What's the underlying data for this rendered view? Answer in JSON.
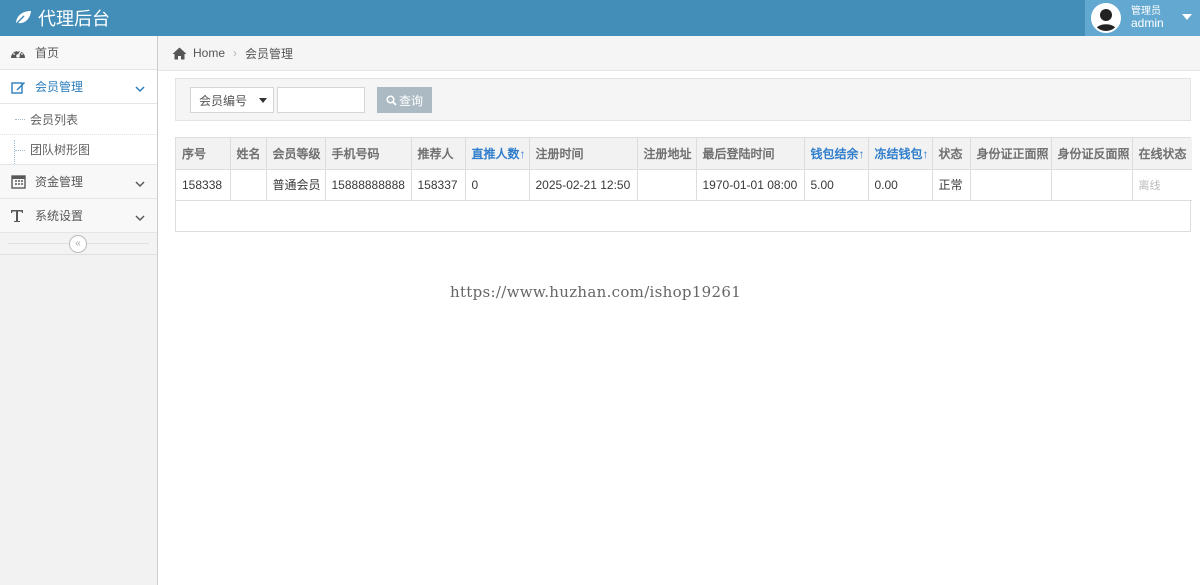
{
  "app": {
    "title": "代理后台"
  },
  "user": {
    "role": "管理员",
    "name": "admin"
  },
  "sidebar": {
    "items": [
      {
        "label": "首页",
        "icon": "dashboard-icon"
      },
      {
        "label": "会员管理",
        "icon": "edit-icon",
        "active": true,
        "children": [
          {
            "label": "会员列表"
          },
          {
            "label": "团队树形图"
          }
        ]
      },
      {
        "label": "资金管理",
        "icon": "calendar-icon"
      },
      {
        "label": "系统设置",
        "icon": "text-icon"
      }
    ],
    "collapse": "«"
  },
  "breadcrumb": {
    "home": "Home",
    "current": "会员管理"
  },
  "search": {
    "field_selected": "会员编号",
    "keyword_value": "",
    "query_label": "查询"
  },
  "table": {
    "headers": [
      "序号",
      "姓名",
      "会员等级",
      "手机号码",
      "推荐人",
      "直推人数↑",
      "注册时间",
      "注册地址",
      "最后登陆时间",
      "钱包结余↑",
      "冻结钱包↑",
      "状态",
      "身份证正面照",
      "身份证反面照",
      "在线状态"
    ],
    "rows": [
      [
        "158338",
        "",
        "普通会员",
        "15888888888",
        "158337",
        "0",
        "2025-02-21 12:50",
        "",
        "1970-01-01 08:00",
        "5.00",
        "0.00",
        "正常",
        "",
        "",
        "离线"
      ]
    ]
  },
  "watermark": "https://www.huzhan.com/ishop19261",
  "colors": {
    "header": "#438eb9",
    "user_box": "#62a8d1",
    "link": "#307ecc",
    "button": "#abbac3"
  }
}
